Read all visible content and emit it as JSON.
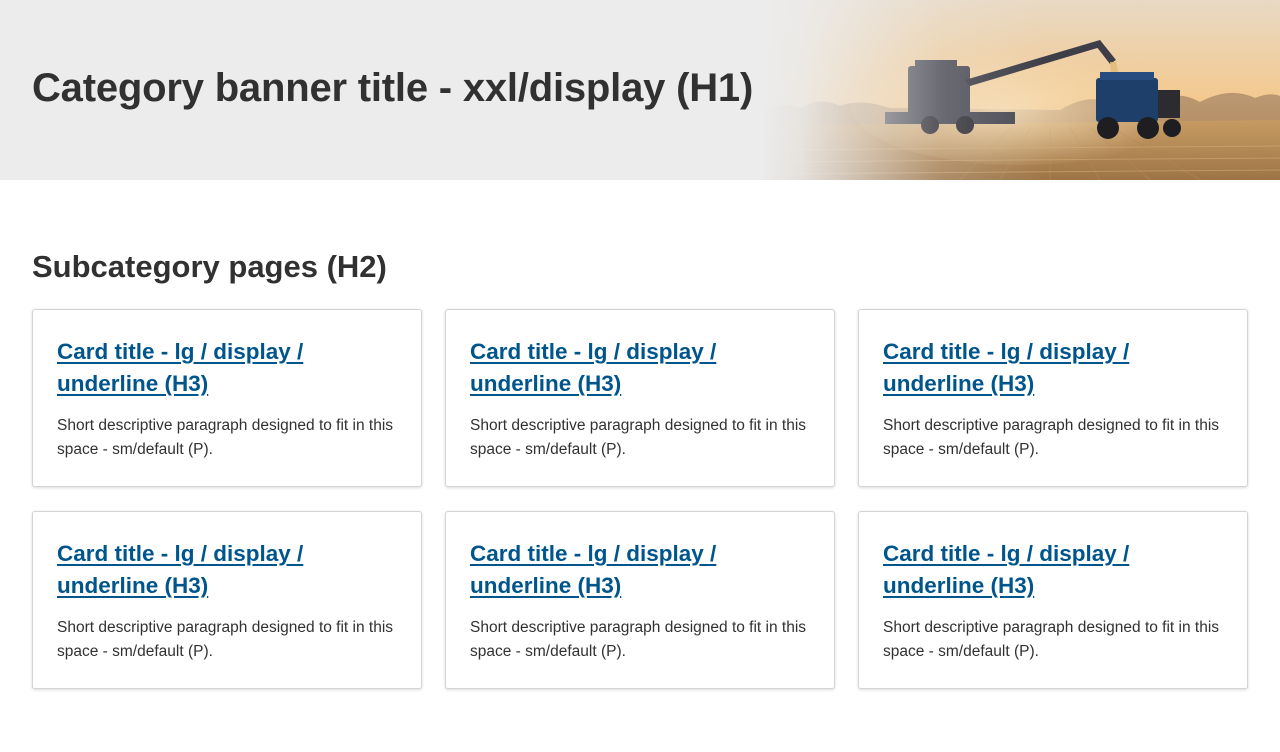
{
  "banner": {
    "title": "Category banner title - xxl/display (H1)"
  },
  "section": {
    "title": "Subcategory pages (H2)"
  },
  "cards": [
    {
      "title": "Card title - lg / display / underline (H3)",
      "text": "Short descriptive paragraph designed to fit in this space - sm/default (P)."
    },
    {
      "title": "Card title - lg / display / underline (H3)",
      "text": "Short descriptive paragraph designed to fit in this space - sm/default (P)."
    },
    {
      "title": "Card title - lg / display / underline (H3)",
      "text": "Short descriptive paragraph designed to fit in this space - sm/default (P)."
    },
    {
      "title": "Card title - lg / display / underline (H3)",
      "text": "Short descriptive paragraph designed to fit in this space - sm/default (P)."
    },
    {
      "title": "Card title - lg / display / underline (H3)",
      "text": "Short descriptive paragraph designed to fit in this space - sm/default (P)."
    },
    {
      "title": "Card title - lg / display / underline (H3)",
      "text": "Short descriptive paragraph designed to fit in this space - sm/default (P)."
    }
  ],
  "colors": {
    "link": "#00558c",
    "text": "#313131",
    "banner_bg": "#ececec"
  }
}
